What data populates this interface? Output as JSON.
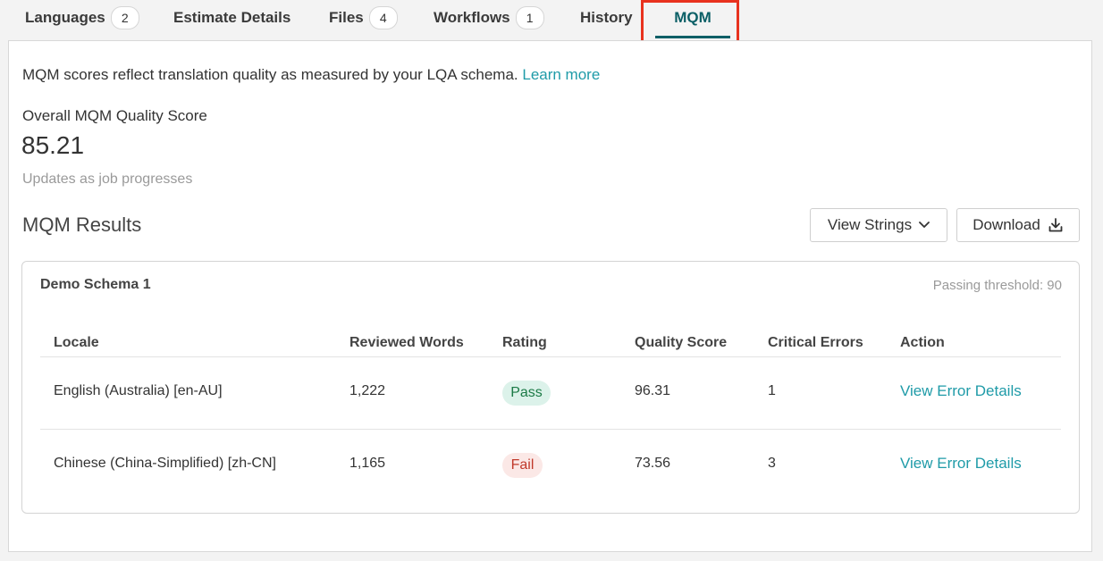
{
  "tabs": [
    {
      "label": "Languages",
      "badge": "2"
    },
    {
      "label": "Estimate Details"
    },
    {
      "label": "Files",
      "badge": "4"
    },
    {
      "label": "Workflows",
      "badge": "1"
    },
    {
      "label": "History"
    },
    {
      "label": "MQM",
      "active": true
    }
  ],
  "intro": {
    "text": "MQM scores reflect translation quality as measured by your LQA schema.",
    "link": "Learn more"
  },
  "overall": {
    "label": "Overall MQM Quality Score",
    "score": "85.21",
    "note": "Updates as job progresses"
  },
  "results": {
    "title": "MQM Results",
    "view_strings_label": "View Strings",
    "download_label": "Download"
  },
  "schema": {
    "name": "Demo Schema 1",
    "threshold": "Passing threshold: 90",
    "columns": [
      "Locale",
      "Reviewed Words",
      "Rating",
      "Quality Score",
      "Critical Errors",
      "Action"
    ],
    "rows": [
      {
        "locale": "English (Australia) [en-AU]",
        "words": "1,222",
        "rating": "Pass",
        "score": "96.31",
        "critical": "1",
        "action": "View Error Details"
      },
      {
        "locale": "Chinese (China-Simplified) [zh-CN]",
        "words": "1,165",
        "rating": "Fail",
        "score": "73.56",
        "critical": "3",
        "action": "View Error Details"
      }
    ]
  },
  "colors": {
    "accent": "#0b5f66",
    "link": "#1f9ba8",
    "highlight": "#e8321e",
    "pass_bg": "#dcf2ea",
    "fail_bg": "#fbe8e6"
  }
}
